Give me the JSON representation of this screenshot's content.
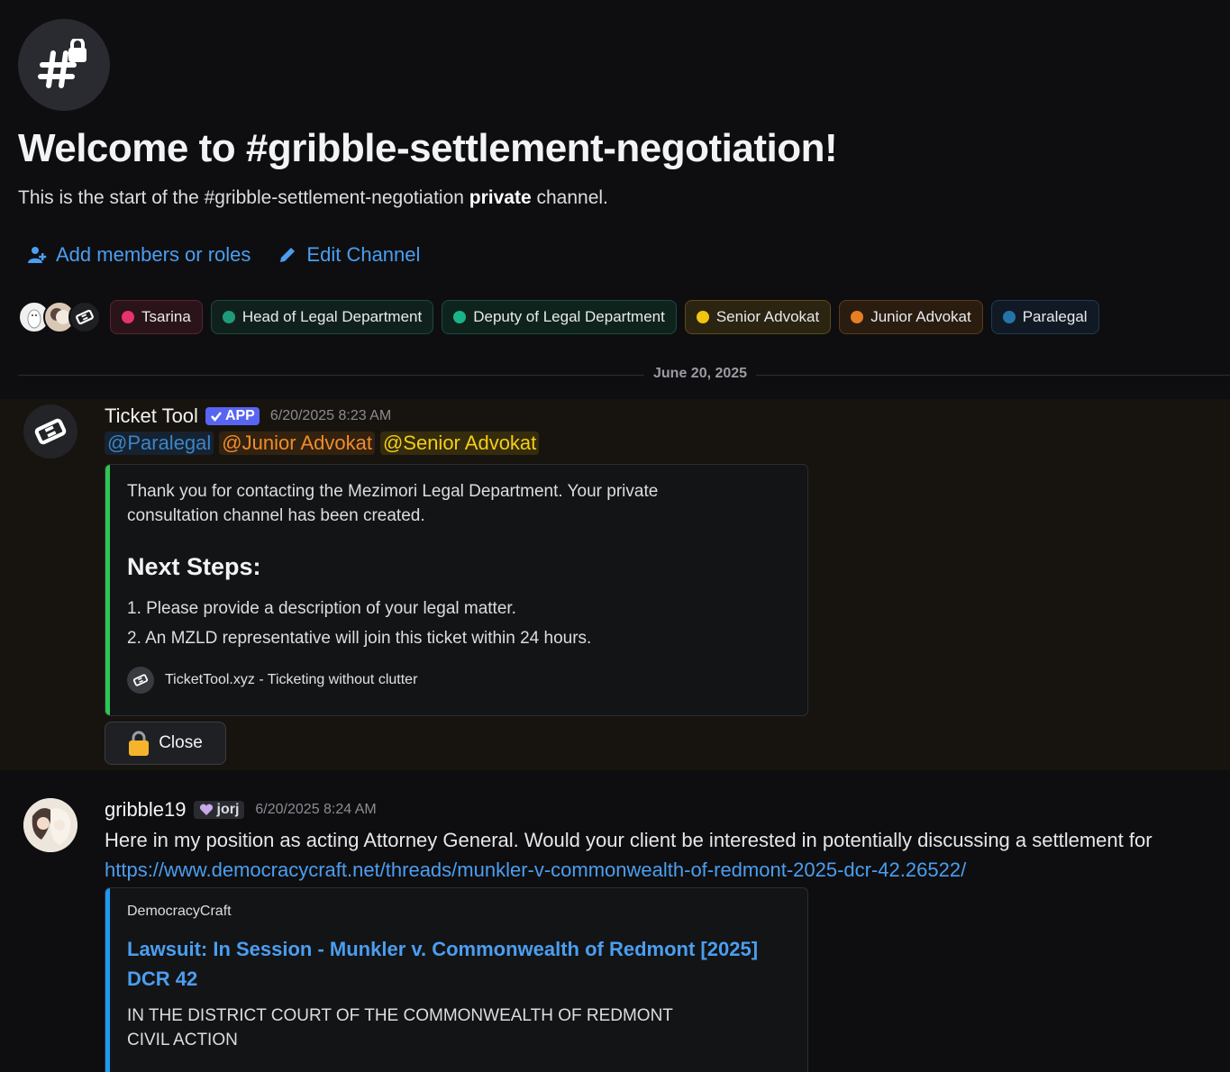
{
  "header": {
    "title": "Welcome to #gribble-settlement-negotiation!",
    "subtitle_before": "This is the start of the #gribble-settlement-negotiation",
    "subtitle_bold": "private",
    "subtitle_after": "channel.",
    "add_members_label": "Add members or roles",
    "edit_channel_label": "Edit Channel"
  },
  "roles": [
    {
      "label": "Tsarina",
      "color": "#e8336a",
      "bg": "#2a1419",
      "border": "#5a2332"
    },
    {
      "label": "Head of Legal Department",
      "color": "#1f9b7b",
      "bg": "#10211d",
      "border": "#1c4a3e"
    },
    {
      "label": "Deputy of Legal Department",
      "color": "#19b48a",
      "bg": "#0f231d",
      "border": "#1a4d3f"
    },
    {
      "label": "Senior Advokat",
      "color": "#f1c40f",
      "bg": "#2a2410",
      "border": "#5a4c1a"
    },
    {
      "label": "Junior Advokat",
      "color": "#e67e22",
      "bg": "#2a1d10",
      "border": "#5c3a1a"
    },
    {
      "label": "Paralegal",
      "color": "#2574a9",
      "bg": "#111a24",
      "border": "#1f3a55"
    }
  ],
  "divider": {
    "date": "June 20, 2025"
  },
  "messages": [
    {
      "author": "Ticket Tool",
      "badge": "APP",
      "timestamp": "6/20/2025 8:23 AM",
      "mentions": [
        {
          "text": "@Paralegal",
          "color": "#3a86c7",
          "bg": "#172230"
        },
        {
          "text": "@Junior Advokat",
          "color": "#f08c2e",
          "bg": "#33220f"
        },
        {
          "text": "@Senior Advokat",
          "color": "#f4ce16",
          "bg": "#352c0e"
        }
      ],
      "embed": {
        "bar_color": "#2dc653",
        "text": "Thank you for contacting the Mezimori Legal Department. Your private consultation channel has been created.",
        "heading": "Next Steps:",
        "steps": [
          "1. Please provide a description of your legal matter.",
          "2. An MZLD representative will join this ticket within 24 hours."
        ],
        "footer": "TicketTool.xyz - Ticketing without clutter"
      },
      "button": {
        "label": "Close",
        "icon": "lock-icon"
      }
    },
    {
      "author": "gribble19",
      "tag": "jorj",
      "timestamp": "6/20/2025 8:24 AM",
      "text": "Here in my position as acting Attorney General. Would your client be interested in potentially discussing a settlement for",
      "link": "https://www.democracycraft.net/threads/munkler-v-commonwealth-of-redmont-2025-dcr-42.26522/",
      "embed": {
        "bar_color": "#1e9bf0",
        "site": "DemocracyCraft",
        "title": "Lawsuit: In Session - Munkler v. Commonwealth of Redmont [2025] DCR 42",
        "desc_line1": "IN THE DISTRICT COURT OF THE COMMONWEALTH OF REDMONT",
        "desc_line2": "CIVIL ACTION"
      }
    }
  ]
}
